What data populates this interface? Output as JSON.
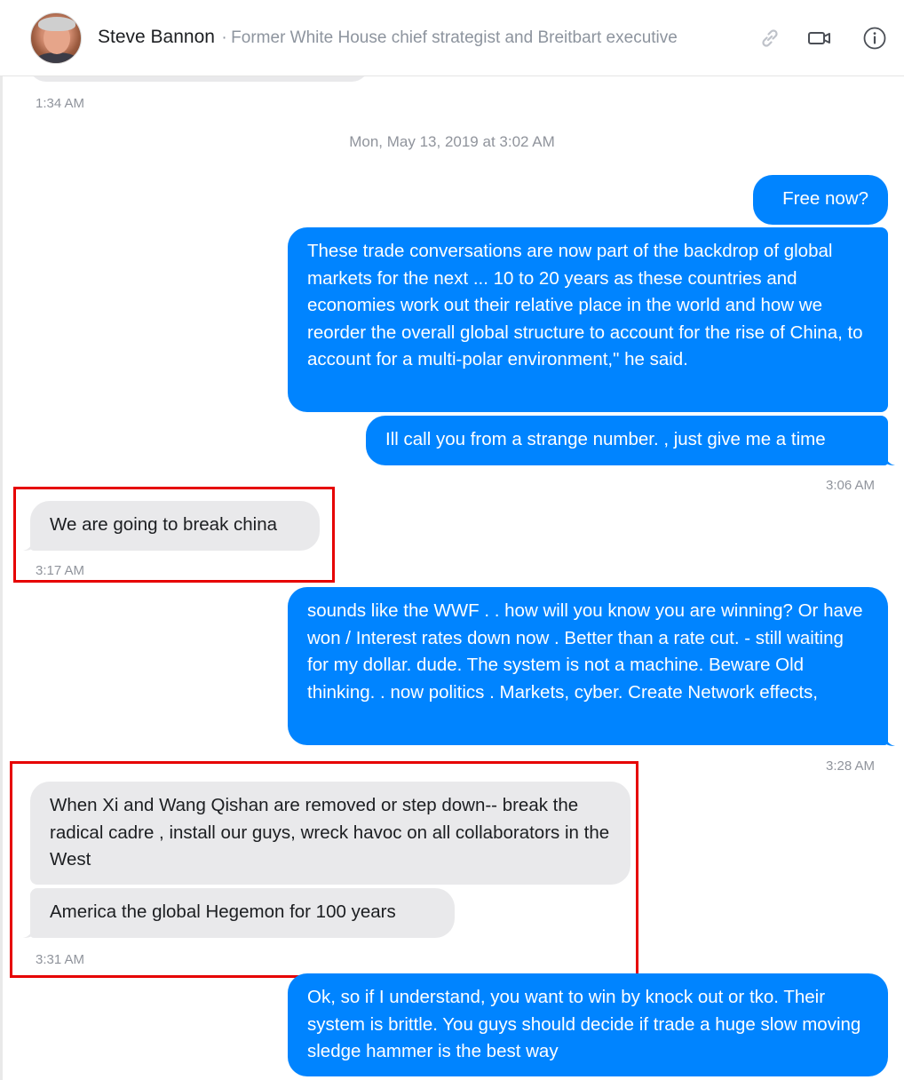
{
  "header": {
    "name": "Steve Bannon",
    "separator": "·",
    "subtitle": "Former White House chief strategist and Breitbart executive",
    "icons": [
      "link-icon",
      "video-call-icon",
      "info-icon"
    ]
  },
  "conversation": {
    "top_timestamp": "1:34 AM",
    "date_separator": "Mon, May 13, 2019 at 3:02 AM",
    "messages": [
      {
        "from": "me",
        "text": "Free now?"
      },
      {
        "from": "me",
        "text": "These trade conversations are now part of the backdrop of global markets for the next ... 10 to 20 years as these countries and economies work out their relative place in the world and how we reorder the overall global structure to account for the rise of China, to account for a multi-polar environment,\" he said."
      },
      {
        "from": "me",
        "text": "Ill call you from a strange number. , just give me a time"
      },
      {
        "from": "them",
        "text": "We are going to break china"
      },
      {
        "from": "me",
        "text": "sounds like the WWF . . how will you know you are winning? Or have won / Interest rates down now . Better than a rate cut. - still waiting for my dollar. dude. The system is not a machine. Beware Old thinking. . now politics . Markets, cyber. Create Network effects,"
      },
      {
        "from": "them",
        "text": "When Xi and Wang Qishan are removed or step down-- break the radical cadre , install our guys, wreck havoc on all collaborators in the West"
      },
      {
        "from": "them",
        "text": "America the global Hegemon for 100 years"
      },
      {
        "from": "me",
        "text": "Ok, so if I understand, you want to win by knock out or tko. Their system is brittle. You guys should decide if trade a huge slow moving sledge hammer is the best way"
      }
    ],
    "timestamps": [
      "3:06 AM",
      "3:17 AM",
      "3:28 AM",
      "3:31 AM"
    ]
  },
  "colors": {
    "outgoing": "#0084ff",
    "incoming": "#e9e9eb",
    "highlight_box": "#e60000"
  }
}
